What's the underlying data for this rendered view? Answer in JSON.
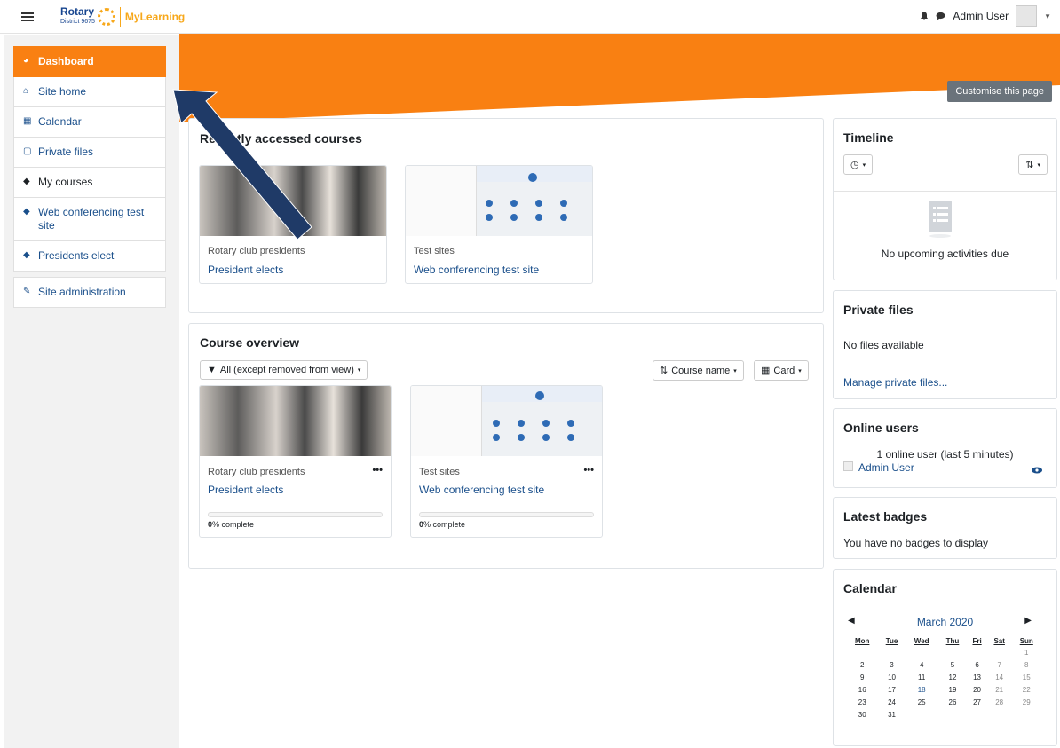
{
  "header": {
    "brand": "Rotary",
    "brand_sub": "District 9675",
    "app_name": "MyLearning",
    "user_name": "Admin User"
  },
  "sidebar": {
    "items": [
      {
        "label": "Dashboard",
        "icon": "dashboard-icon",
        "active": true
      },
      {
        "label": "Site home",
        "icon": "home-icon"
      },
      {
        "label": "Calendar",
        "icon": "calendar-icon"
      },
      {
        "label": "Private files",
        "icon": "file-icon"
      },
      {
        "label": "My courses",
        "icon": "graduation-cap-icon"
      },
      {
        "label": "Web conferencing test site",
        "icon": "graduation-cap-icon"
      },
      {
        "label": "Presidents elect",
        "icon": "graduation-cap-icon"
      },
      {
        "label": "Site administration",
        "icon": "wrench-icon"
      }
    ]
  },
  "main": {
    "customise_label": "Customise this page",
    "recent": {
      "title": "Recently accessed courses",
      "courses": [
        {
          "category": "Rotary club presidents",
          "name": "President elects"
        },
        {
          "category": "Test sites",
          "name": "Web conferencing test site"
        }
      ]
    },
    "overview": {
      "title": "Course overview",
      "filter_label": "All (except removed from view)",
      "sort_label": "Course name",
      "view_label": "Card",
      "courses": [
        {
          "category": "Rotary club presidents",
          "name": "President elects",
          "progress_pct": "0",
          "progress_suffix": "% complete",
          "progress_fraction": 0
        },
        {
          "category": "Test sites",
          "name": "Web conferencing test site",
          "progress_pct": "0",
          "progress_suffix": "% complete",
          "progress_fraction": 0
        }
      ]
    }
  },
  "blocks": {
    "timeline": {
      "title": "Timeline",
      "empty": "No upcoming activities due"
    },
    "private_files": {
      "title": "Private files",
      "empty": "No files available",
      "manage_link": "Manage private files..."
    },
    "online_users": {
      "title": "Online users",
      "summary": "1 online user (last 5 minutes)",
      "user": "Admin User"
    },
    "badges": {
      "title": "Latest badges",
      "empty": "You have no badges to display"
    },
    "calendar": {
      "title": "Calendar",
      "month": "March 2020",
      "days": [
        "Mon",
        "Tue",
        "Wed",
        "Thu",
        "Fri",
        "Sat",
        "Sun"
      ],
      "weeks": [
        [
          "",
          "",
          "",
          "",
          "",
          "",
          "1"
        ],
        [
          "2",
          "3",
          "4",
          "5",
          "6",
          "7",
          "8"
        ],
        [
          "9",
          "10",
          "11",
          "12",
          "13",
          "14",
          "15"
        ],
        [
          "16",
          "17",
          "18",
          "19",
          "20",
          "21",
          "22"
        ],
        [
          "23",
          "24",
          "25",
          "26",
          "27",
          "28",
          "29"
        ],
        [
          "30",
          "31",
          "",
          "",
          "",
          "",
          ""
        ]
      ],
      "today": "18"
    }
  },
  "colors": {
    "accent": "#f98012",
    "link": "#1a4f8b",
    "brand_blue": "#17458f",
    "brand_gold": "#f7a81b",
    "arrow": "#1f3a67"
  }
}
